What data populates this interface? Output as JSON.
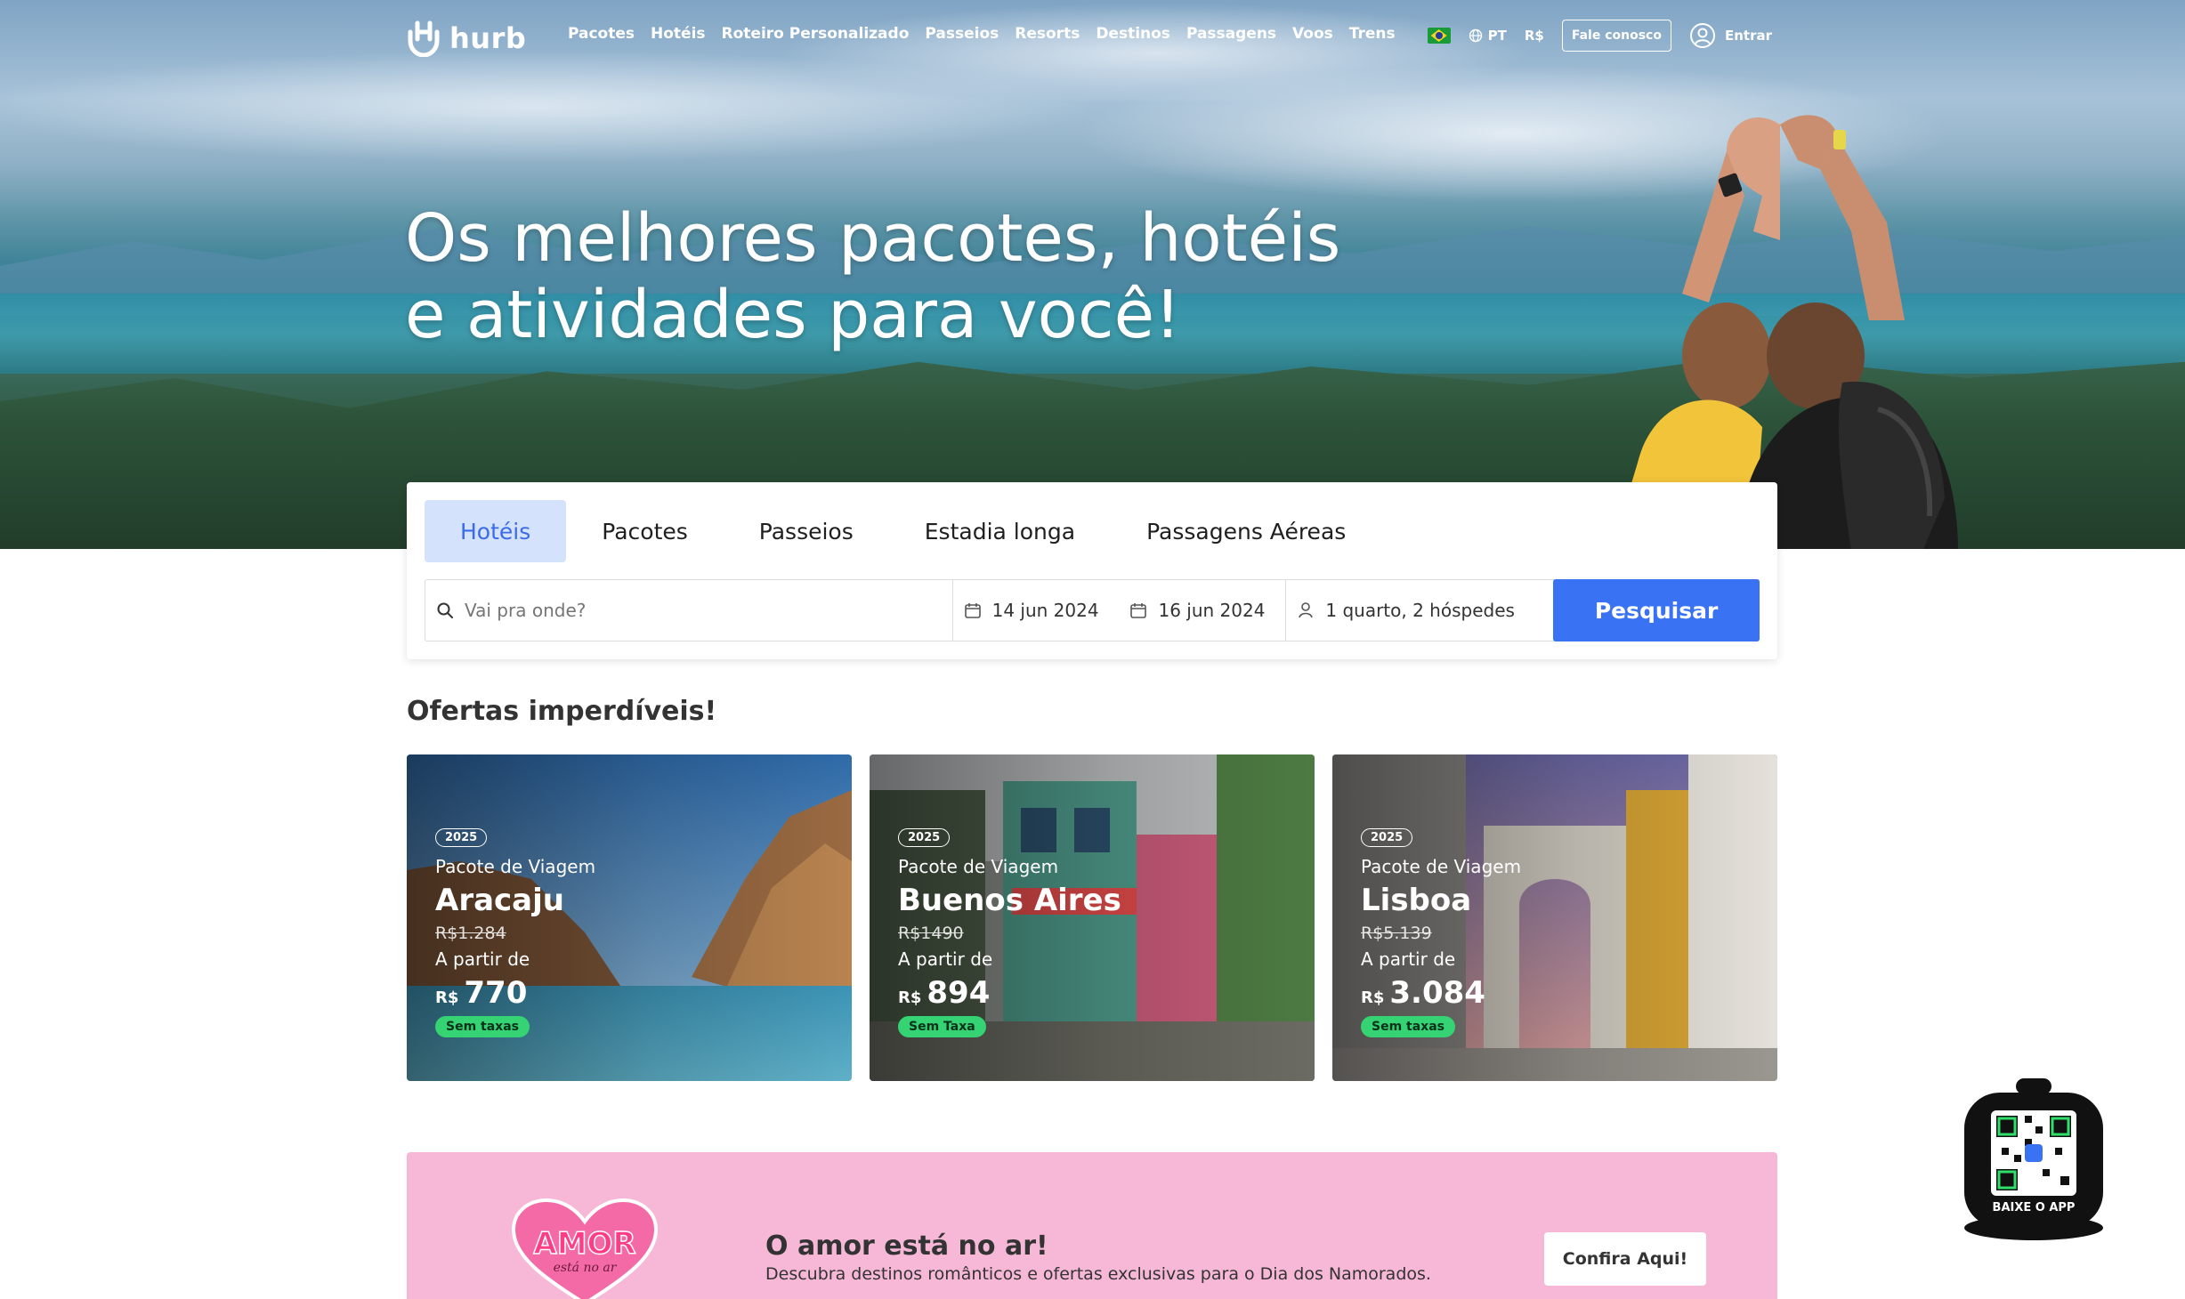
{
  "brand": {
    "name": "hurb"
  },
  "nav": {
    "items": [
      "Pacotes",
      "Hotéis",
      "Roteiro Personalizado",
      "Passeios",
      "Resorts",
      "Destinos",
      "Passagens",
      "Voos",
      "Trens"
    ],
    "language": "PT",
    "currency": "R$",
    "contact_label": "Fale conosco",
    "login_label": "Entrar"
  },
  "hero": {
    "headline_line1": "Os melhores pacotes, hotéis",
    "headline_line2": "e atividades para você!"
  },
  "search": {
    "tabs": [
      "Hotéis",
      "Pacotes",
      "Passeios",
      "Estadia longa",
      "Passagens Aéreas"
    ],
    "active_tab": "Hotéis",
    "destination_placeholder": "Vai pra onde?",
    "checkin": "14 jun 2024",
    "checkout": "16 jun 2024",
    "guests": "1 quarto, 2 hóspedes",
    "button_label": "Pesquisar"
  },
  "offers": {
    "title": "Ofertas imperdíveis!",
    "cards": [
      {
        "year": "2025",
        "kind": "Pacote de Viagem",
        "city": "Aracaju",
        "old_price": "R$1.284",
        "from_label": "A partir de",
        "currency": "R$",
        "price": "770",
        "tax": "Sem taxas"
      },
      {
        "year": "2025",
        "kind": "Pacote de Viagem",
        "city": "Buenos Aires",
        "old_price": "R$1490",
        "from_label": "A partir de",
        "currency": "R$",
        "price": "894",
        "tax": "Sem Taxa"
      },
      {
        "year": "2025",
        "kind": "Pacote de Viagem",
        "city": "Lisboa",
        "old_price": "R$5.139",
        "from_label": "A partir de",
        "currency": "R$",
        "price": "3.084",
        "tax": "Sem taxas"
      }
    ]
  },
  "promo": {
    "badge_text": "AMOR",
    "badge_sub": "está no ar",
    "title": "O amor está no ar!",
    "description": "Descubra destinos românticos e ofertas exclusivas para o Dia dos Namorados.",
    "button_label": "Confira Aqui!"
  },
  "app": {
    "label": "BAIXE O APP"
  },
  "colors": {
    "accent": "#3a72f4",
    "tab_active_bg": "#d4e2fc",
    "promo_bg": "#f7b8d8",
    "tax_badge": "#35d373"
  }
}
